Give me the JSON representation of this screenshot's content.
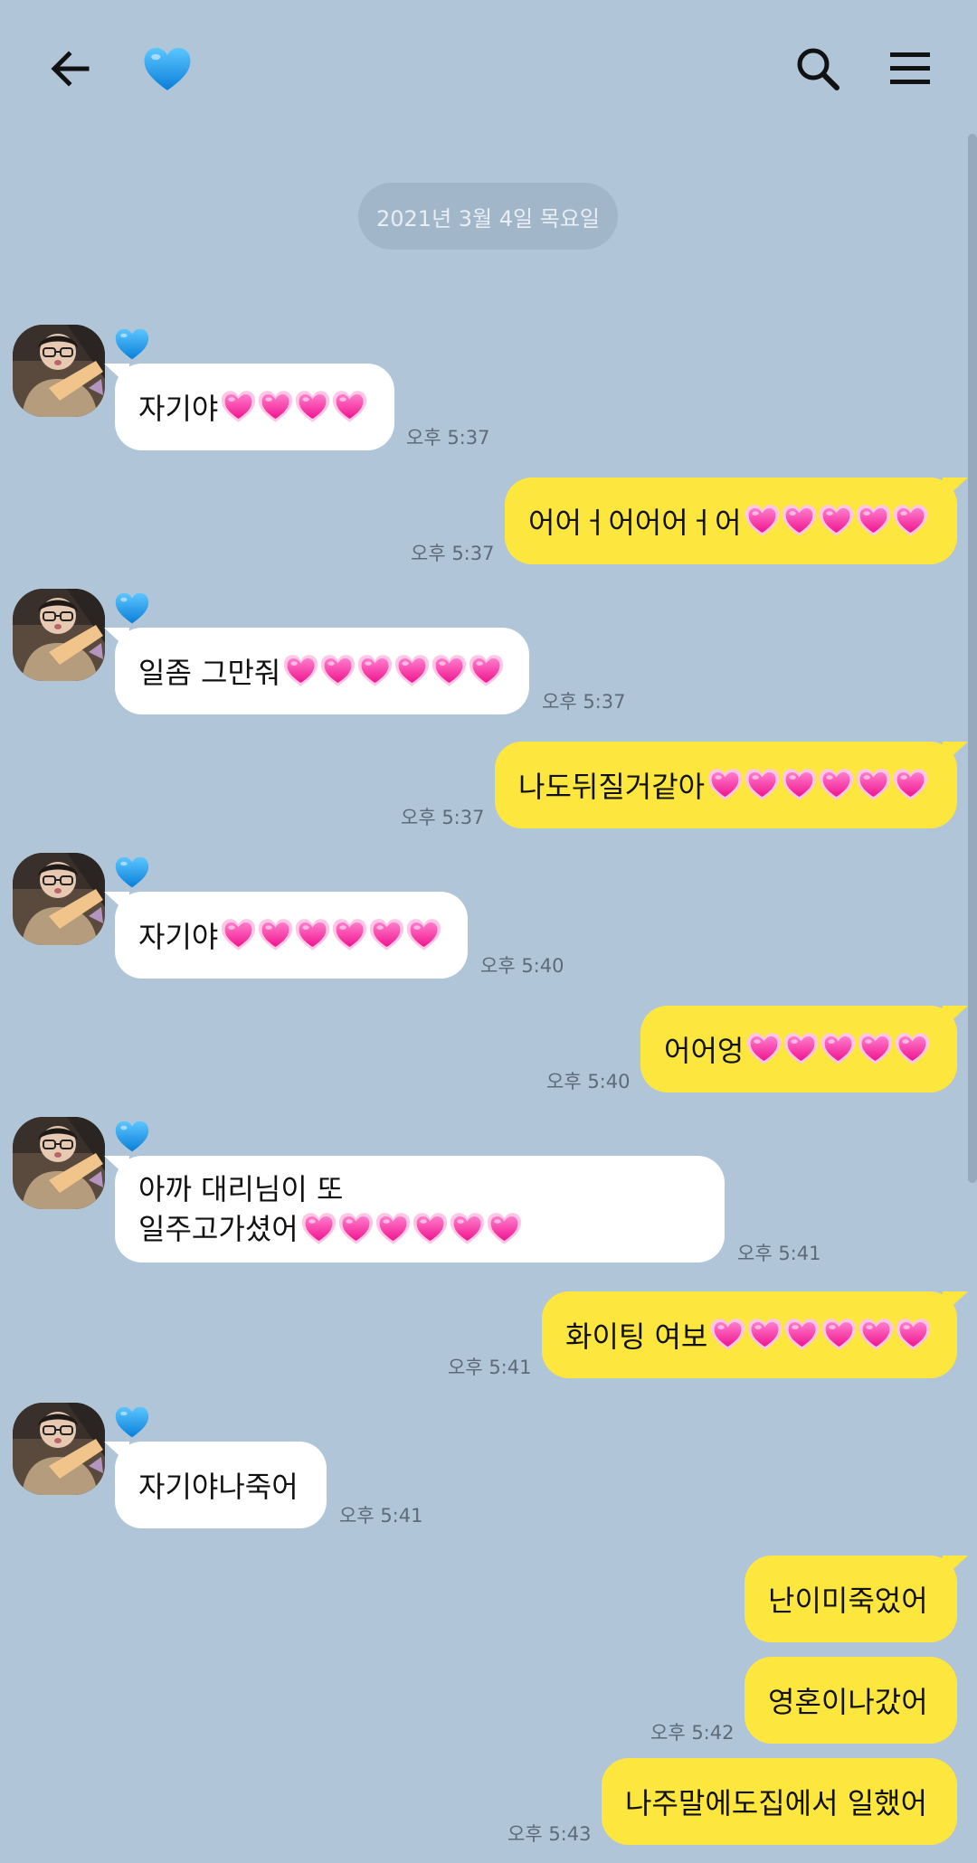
{
  "header": {
    "back_icon": "arrow-left-icon",
    "title_icon": "blue-heart-icon",
    "search_icon": "search-icon",
    "menu_icon": "hamburger-menu-icon"
  },
  "date_divider": "2021년 3월 4일 목요일",
  "colors": {
    "background": "#b1c5d9",
    "outgoing_bubble": "#fde73f",
    "incoming_bubble": "#ffffff",
    "heart_pink": "#ff3da8",
    "blue_heart": "#1f9cf0"
  },
  "messages": [
    {
      "dir": "in",
      "text": "자기야",
      "hearts": 4,
      "time": "오후 5:37"
    },
    {
      "dir": "out",
      "text": "어어ㅓ어어어ㅓ어",
      "hearts": 5,
      "time": "오후 5:37"
    },
    {
      "dir": "in",
      "text": "일좀 그만줘",
      "hearts": 6,
      "time": "오후 5:37"
    },
    {
      "dir": "out",
      "text": "나도뒤질거같아",
      "hearts": 6,
      "time": "오후 5:37"
    },
    {
      "dir": "in",
      "text": "자기야",
      "hearts": 6,
      "time": "오후 5:40"
    },
    {
      "dir": "out",
      "text": "어어엉",
      "hearts": 5,
      "time": "오후 5:40"
    },
    {
      "dir": "in",
      "line1": "아까 대리님이 또",
      "text": "일주고가셨어",
      "hearts": 6,
      "time": "오후 5:41"
    },
    {
      "dir": "out",
      "text": "화이팅 여보",
      "hearts": 6,
      "time": "오후 5:41"
    },
    {
      "dir": "in",
      "text": "자기야나죽어",
      "hearts": 0,
      "time": "오후 5:41"
    },
    {
      "dir": "out",
      "text": "난이미죽었어",
      "hearts": 0,
      "time": ""
    },
    {
      "dir": "out",
      "text": "영혼이나갔어",
      "hearts": 0,
      "time": "오후 5:42"
    },
    {
      "dir": "out",
      "text": "나주말에도집에서 일했어",
      "hearts": 0,
      "time": "오후 5:43"
    }
  ]
}
